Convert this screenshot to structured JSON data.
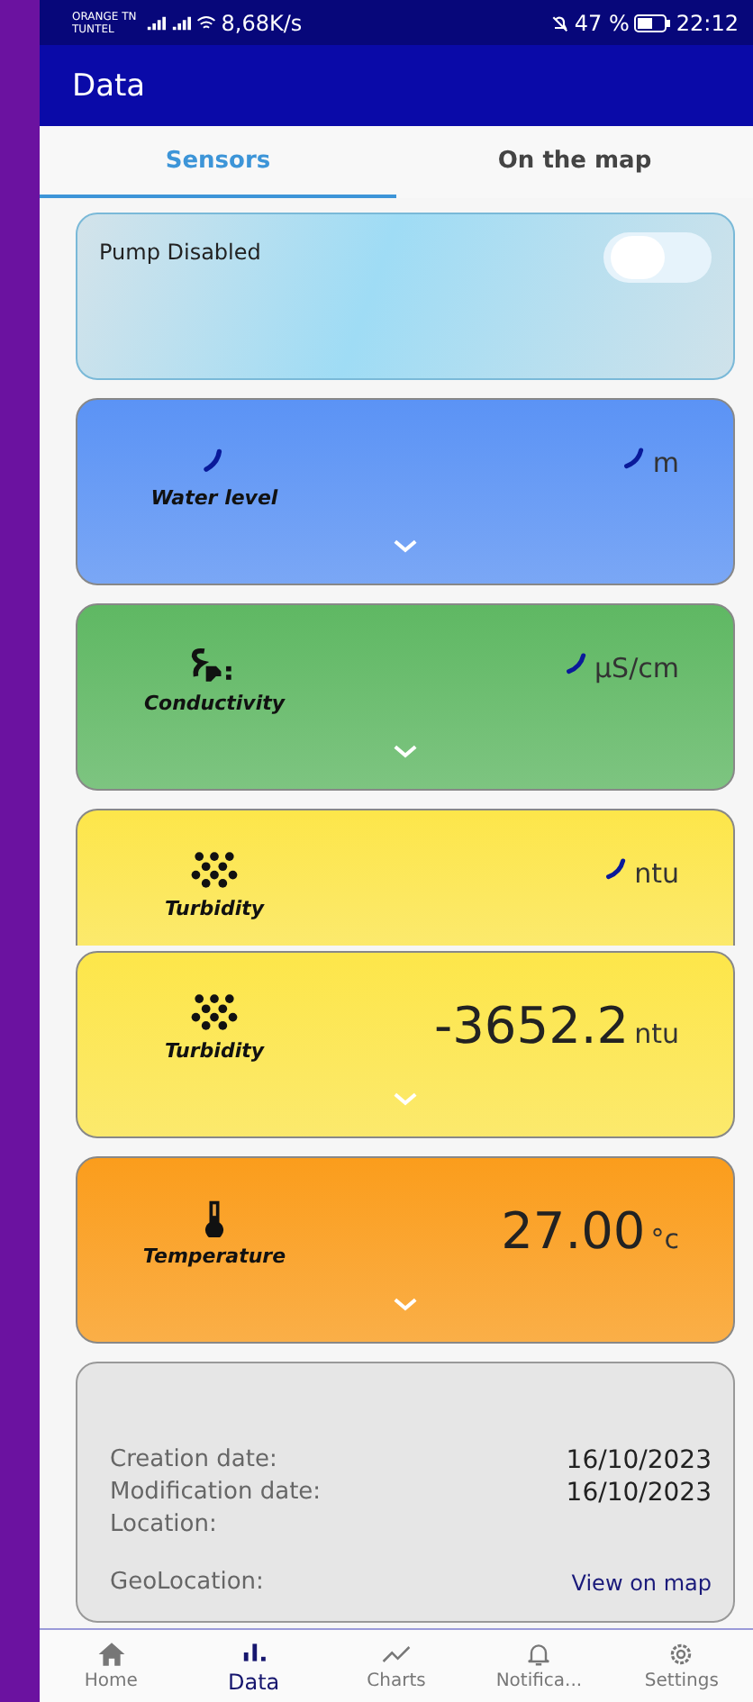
{
  "status_bar": {
    "carrier": "ORANGE TN",
    "carrier_2": "TUNTEL",
    "speed": "8,68K/s",
    "battery": "47 %",
    "time": "22:12"
  },
  "app_bar": {
    "title": "Data"
  },
  "tabs": [
    {
      "label": "Sensors",
      "selected": true
    },
    {
      "label": "On the map",
      "selected": false
    }
  ],
  "pump": {
    "label": "Pump Disabled",
    "on": false
  },
  "sensors": [
    {
      "name": "Water level",
      "kind": "spinner",
      "loading": true,
      "unit": "m",
      "color": "#5b93f5",
      "clipped": false
    },
    {
      "name": "Conductivity",
      "kind": "plug",
      "loading": true,
      "unit": "µS/cm",
      "color": "#5fb863",
      "clipped": false
    },
    {
      "name": "Turbidity",
      "kind": "dots",
      "loading": true,
      "unit": "ntu",
      "color": "#fde64a",
      "clipped": true
    },
    {
      "name": "Turbidity",
      "kind": "dots",
      "loading": false,
      "value": "-3652.2",
      "unit": "ntu",
      "color": "#fde64a",
      "clipped": false
    },
    {
      "name": "Temperature",
      "kind": "thermometer",
      "loading": false,
      "value": "27.00",
      "unit": "°c",
      "color": "#fb9d1c",
      "clipped": false
    }
  ],
  "info": [
    {
      "label": "Creation date:",
      "value": "16/10/2023",
      "kind": "text"
    },
    {
      "label": "Modification date:",
      "value": "16/10/2023",
      "kind": "text"
    },
    {
      "label": "Location:",
      "kind": "text"
    },
    {
      "label": "GeoLocation:",
      "value": "View on map",
      "kind": "link"
    }
  ],
  "nav": [
    {
      "label": "Home",
      "kind": "home",
      "selected": false
    },
    {
      "label": "Data",
      "kind": "bars",
      "selected": true
    },
    {
      "label": "Charts",
      "kind": "chart",
      "selected": false
    },
    {
      "label": "Notifica...",
      "kind": "bell",
      "selected": false
    },
    {
      "label": "Settings",
      "kind": "gear",
      "selected": false
    }
  ]
}
